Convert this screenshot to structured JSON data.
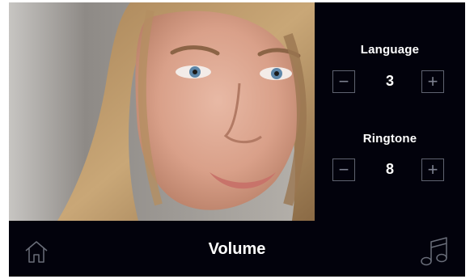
{
  "language": {
    "label": "Language",
    "value": "3",
    "minus": "−",
    "plus": "+"
  },
  "ringtone": {
    "label": "Ringtone",
    "value": "8",
    "minus": "−",
    "plus": "+"
  },
  "footer": {
    "title": "Volume"
  },
  "icons": {
    "home": "home-icon",
    "music": "music-icon"
  },
  "colors": {
    "background": "#02020c",
    "text": "#ffffff",
    "control_border": "#5f6370"
  }
}
